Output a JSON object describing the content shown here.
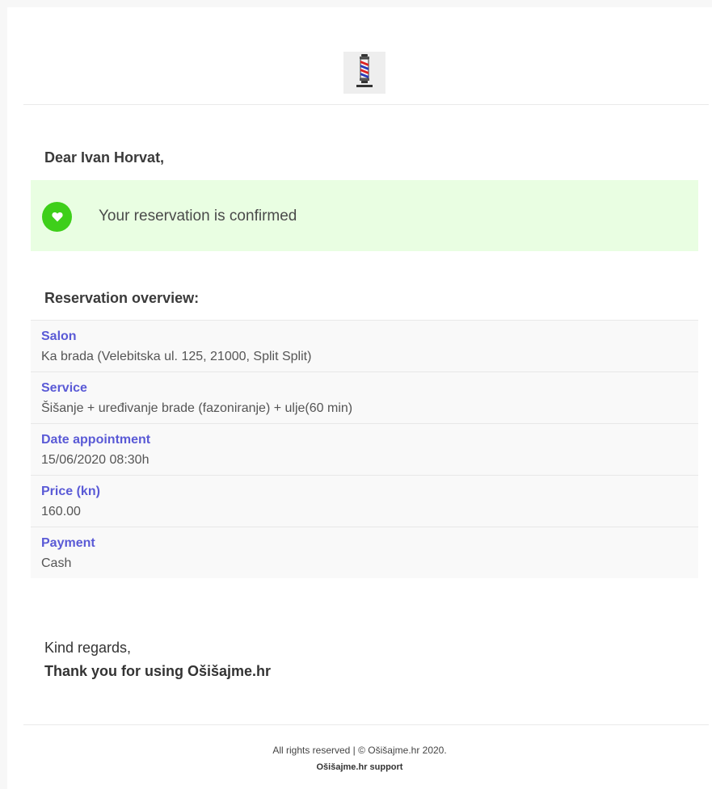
{
  "header": {
    "logo_icon": "barber-pole-icon"
  },
  "greeting": "Dear Ivan Horvat,",
  "alert": {
    "icon": "heart-icon",
    "message": "Your reservation is confirmed",
    "background": "#e9fee2",
    "icon_color": "#3ecf1a"
  },
  "overview": {
    "title": "Reservation overview:",
    "rows": [
      {
        "label": "Salon",
        "value": "Ka brada (Velebitska ul. 125, 21000, Split Split)"
      },
      {
        "label": "Service",
        "value": "Šišanje + uređivanje brade (fazoniranje) + ulje(60 min)"
      },
      {
        "label": "Date appointment",
        "value": "15/06/2020 08:30h"
      },
      {
        "label": "Price (kn)",
        "value": "160.00"
      },
      {
        "label": "Payment",
        "value": "Cash"
      }
    ],
    "label_color": "#5a5ad6"
  },
  "closing": {
    "regards": "Kind regards,",
    "thanks": "Thank you for using Ošišajme.hr"
  },
  "footer": {
    "rights": "All rights reserved | © Ošišajme.hr 2020.",
    "support": "Ošišajme.hr support"
  }
}
